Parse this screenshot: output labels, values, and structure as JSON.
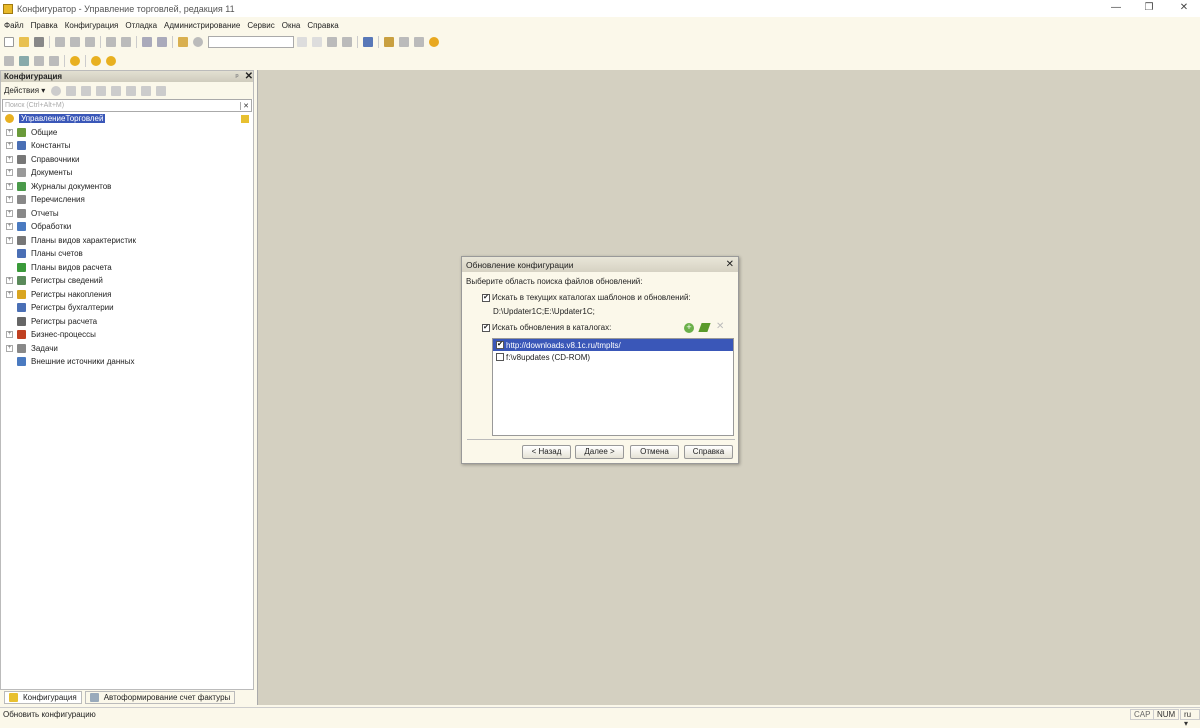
{
  "window": {
    "title": "Конфигуратор - Управление торговлей, редакция 11",
    "min": "—",
    "restore": "❐",
    "close": "✕"
  },
  "menu": [
    "Файл",
    "Правка",
    "Конфигурация",
    "Отладка",
    "Администрирование",
    "Сервис",
    "Окна",
    "Справка"
  ],
  "panel": {
    "title": "Конфигурация",
    "pin": "ᵖ",
    "close": "✕",
    "actions": "Действия ▾",
    "search_placeholder": "Поиск (Ctrl+Alt+M)",
    "search_clear": "✕",
    "root": "УправлениеТорговлей",
    "items": [
      {
        "label": "Общие",
        "exp": true,
        "color": "#6a9a3a"
      },
      {
        "label": "Константы",
        "exp": true,
        "color": "#4a6fb5"
      },
      {
        "label": "Справочники",
        "exp": true,
        "color": "#777"
      },
      {
        "label": "Документы",
        "exp": true,
        "color": "#999"
      },
      {
        "label": "Журналы документов",
        "exp": true,
        "color": "#4a9a4a"
      },
      {
        "label": "Перечисления",
        "exp": true,
        "color": "#888"
      },
      {
        "label": "Отчеты",
        "exp": true,
        "color": "#888"
      },
      {
        "label": "Обработки",
        "exp": true,
        "color": "#4a7ac0"
      },
      {
        "label": "Планы видов характеристик",
        "exp": true,
        "color": "#777"
      },
      {
        "label": "Планы счетов",
        "exp": false,
        "color": "#4a6fb5"
      },
      {
        "label": "Планы видов расчета",
        "exp": false,
        "color": "#3a9a3a"
      },
      {
        "label": "Регистры сведений",
        "exp": true,
        "color": "#5a8a5a"
      },
      {
        "label": "Регистры накопления",
        "exp": true,
        "color": "#d9a520"
      },
      {
        "label": "Регистры бухгалтерии",
        "exp": false,
        "color": "#4a6fb5"
      },
      {
        "label": "Регистры расчета",
        "exp": false,
        "color": "#666"
      },
      {
        "label": "Бизнес-процессы",
        "exp": true,
        "color": "#c04020"
      },
      {
        "label": "Задачи",
        "exp": true,
        "color": "#888"
      },
      {
        "label": "Внешние источники данных",
        "exp": false,
        "color": "#4a7ac0"
      }
    ]
  },
  "dialog": {
    "title": "Обновление конфигурации",
    "close": "✕",
    "prompt": "Выберите область поиска файлов обновлений:",
    "opt1": "Искать в текущих каталогах шаблонов и обновлений:",
    "paths": "D:\\Updater1C;E:\\Updater1C;",
    "opt2": "Искать обновления в каталогах:",
    "list": [
      {
        "label": "http://downloads.v8.1c.ru/tmplts/",
        "checked": true
      },
      {
        "label": "f:\\v8updates (CD-ROM)",
        "checked": false
      }
    ],
    "buttons": {
      "back": "< Назад",
      "next": "Далее >",
      "cancel": "Отмена",
      "help": "Справка"
    }
  },
  "tabs": [
    "Конфигурация",
    "Автоформирование счет фактуры"
  ],
  "status": {
    "text": "Обновить конфигурацию",
    "cap": "CAP",
    "num": "NUM",
    "lang": "ru ▾"
  },
  "check": "✔"
}
